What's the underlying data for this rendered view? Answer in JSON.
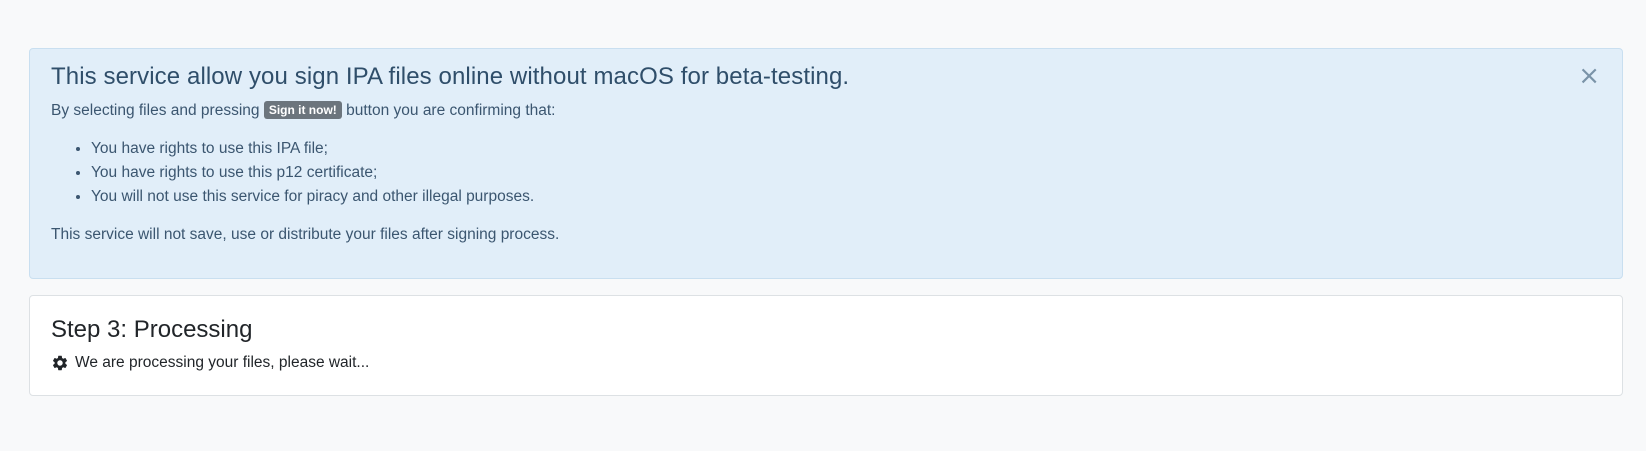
{
  "alert": {
    "title": "This service allow you sign IPA files online without macOS for beta-testing.",
    "intro_before": "By selecting files and pressing ",
    "badge_label": "Sign it now!",
    "intro_after": " button you are confirming that:",
    "rules": [
      "You have rights to use this IPA file;",
      "You have rights to use this p12 certificate;",
      "You will not use this service for piracy and other illegal purposes."
    ],
    "footer": "This service will not save, use or distribute your files after signing process.",
    "close_glyph": "×"
  },
  "step": {
    "title": "Step 3: Processing",
    "status_text": "We are processing your files, please wait...",
    "icon": "gear-icon"
  },
  "colors": {
    "alert_background": "#e1eef9",
    "alert_text": "#3b5670",
    "badge_background": "#6c757d",
    "page_background": "#f8f9fa"
  }
}
